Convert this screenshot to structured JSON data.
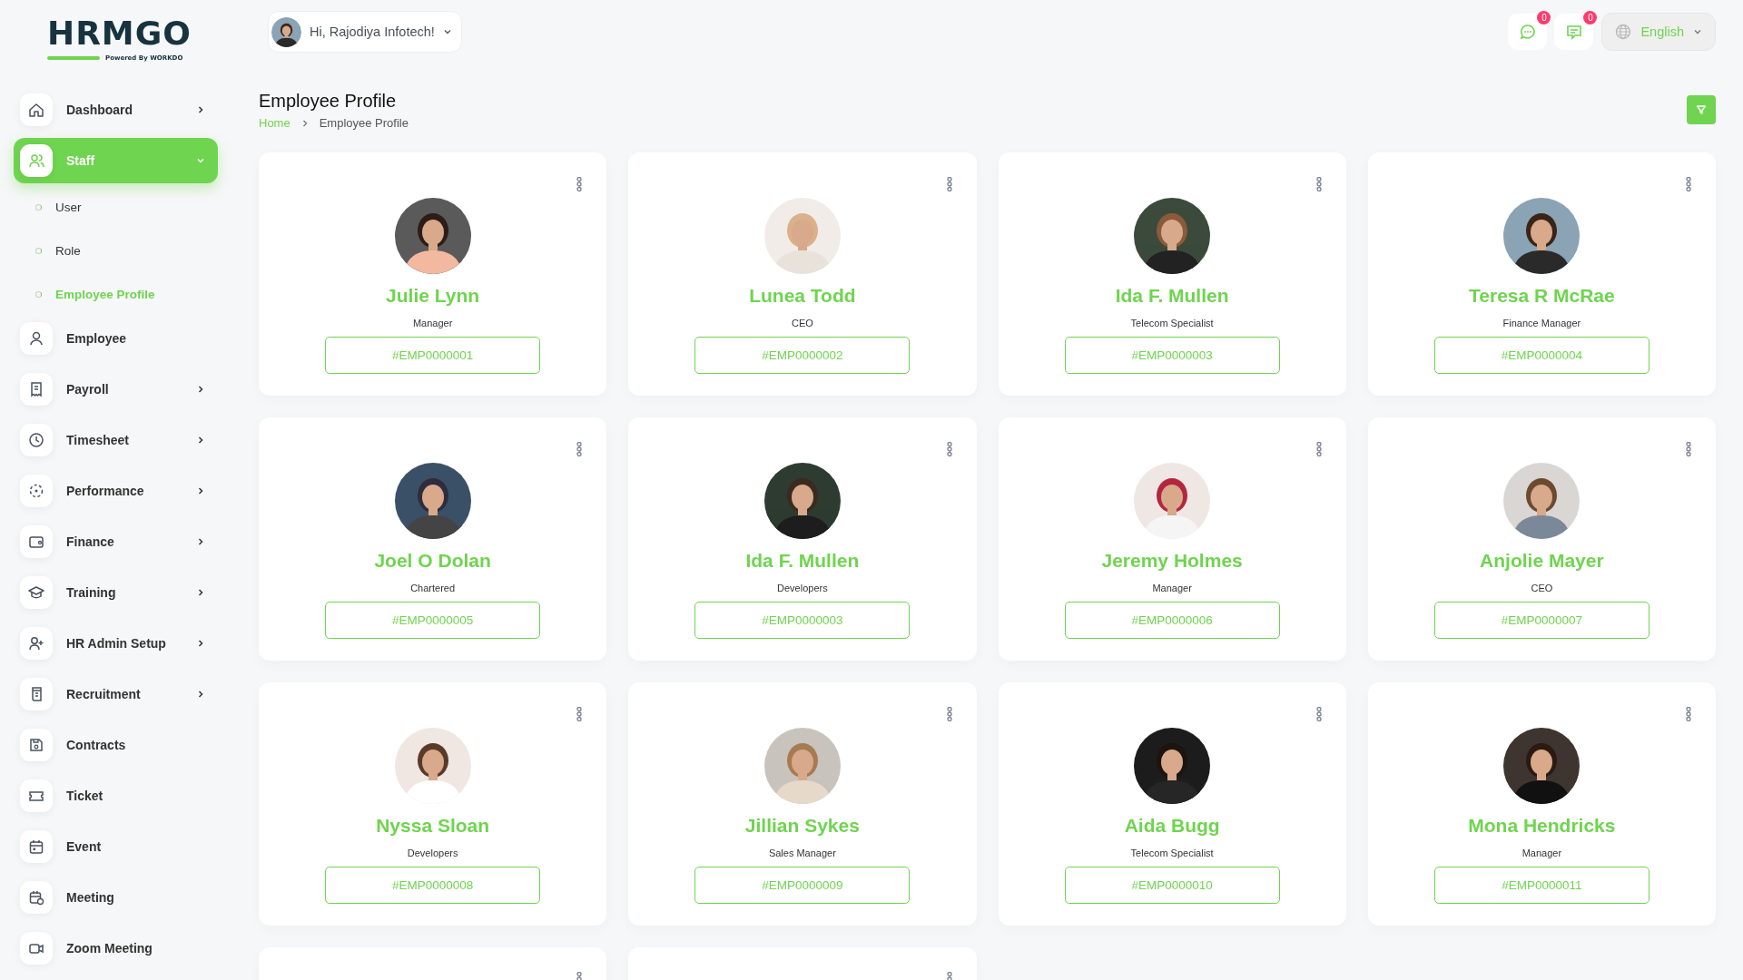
{
  "brand": {
    "logo_main": "HRMGO",
    "tagline": "Powered By WORKDO"
  },
  "user_menu": {
    "greeting": "Hi, Rajodiya Infotech!"
  },
  "notifications": [
    {
      "count": "0"
    },
    {
      "count": "0"
    }
  ],
  "language": {
    "label": "English"
  },
  "page": {
    "title": "Employee Profile",
    "breadcrumbs": [
      {
        "label": "Home",
        "selected": false
      },
      {
        "label": "Employee Profile",
        "selected": true
      }
    ]
  },
  "sidebar": {
    "items": [
      {
        "label": "Dashboard",
        "selected": false,
        "expanded": false
      },
      {
        "label": "Staff",
        "selected": true,
        "expanded": true,
        "children": [
          {
            "label": "User",
            "selected": false
          },
          {
            "label": "Role",
            "selected": false
          },
          {
            "label": "Employee Profile",
            "selected": true
          }
        ]
      },
      {
        "label": "Employee",
        "selected": false
      },
      {
        "label": "Payroll",
        "selected": false,
        "expanded": false
      },
      {
        "label": "Timesheet",
        "selected": false,
        "expanded": false
      },
      {
        "label": "Performance",
        "selected": false,
        "expanded": false
      },
      {
        "label": "Finance",
        "selected": false,
        "expanded": false
      },
      {
        "label": "Training",
        "selected": false,
        "expanded": false
      },
      {
        "label": "HR Admin Setup",
        "selected": false,
        "expanded": false
      },
      {
        "label": "Recruitment",
        "selected": false,
        "expanded": false
      },
      {
        "label": "Contracts",
        "selected": false
      },
      {
        "label": "Ticket",
        "selected": false
      },
      {
        "label": "Event",
        "selected": false
      },
      {
        "label": "Meeting",
        "selected": false
      },
      {
        "label": "Zoom Meeting",
        "selected": false
      }
    ]
  },
  "employees": [
    {
      "kind": "full",
      "name": "Julie Lynn",
      "role": "Manager",
      "id": "#EMP0000001"
    },
    {
      "kind": "full",
      "name": "Lunea Todd",
      "role": "CEO",
      "id": "#EMP0000002"
    },
    {
      "kind": "full",
      "name": "Ida F. Mullen",
      "role": "Telecom Specialist",
      "id": "#EMP0000003"
    },
    {
      "kind": "full",
      "name": "Teresa R McRae",
      "role": "Finance Manager",
      "id": "#EMP0000004"
    },
    {
      "kind": "full",
      "name": "Joel O Dolan",
      "role": "Chartered",
      "id": "#EMP0000005"
    },
    {
      "kind": "full",
      "name": "Ida F. Mullen",
      "role": "Developers",
      "id": "#EMP0000003"
    },
    {
      "kind": "full",
      "name": "Jeremy Holmes",
      "role": "Manager",
      "id": "#EMP0000006"
    },
    {
      "kind": "full",
      "name": "Anjolie Mayer",
      "role": "CEO",
      "id": "#EMP0000007"
    },
    {
      "kind": "full",
      "name": "Nyssa Sloan",
      "role": "Developers",
      "id": "#EMP0000008"
    },
    {
      "kind": "full",
      "name": "Jillian Sykes",
      "role": "Sales Manager",
      "id": "#EMP0000009"
    },
    {
      "kind": "full",
      "name": "Aida Bugg",
      "role": "Telecom Specialist",
      "id": "#EMP0000010"
    },
    {
      "kind": "full",
      "name": "Mona Hendricks",
      "role": "Manager",
      "id": "#EMP0000011"
    },
    {
      "kind": "cut"
    },
    {
      "kind": "cut"
    }
  ]
}
